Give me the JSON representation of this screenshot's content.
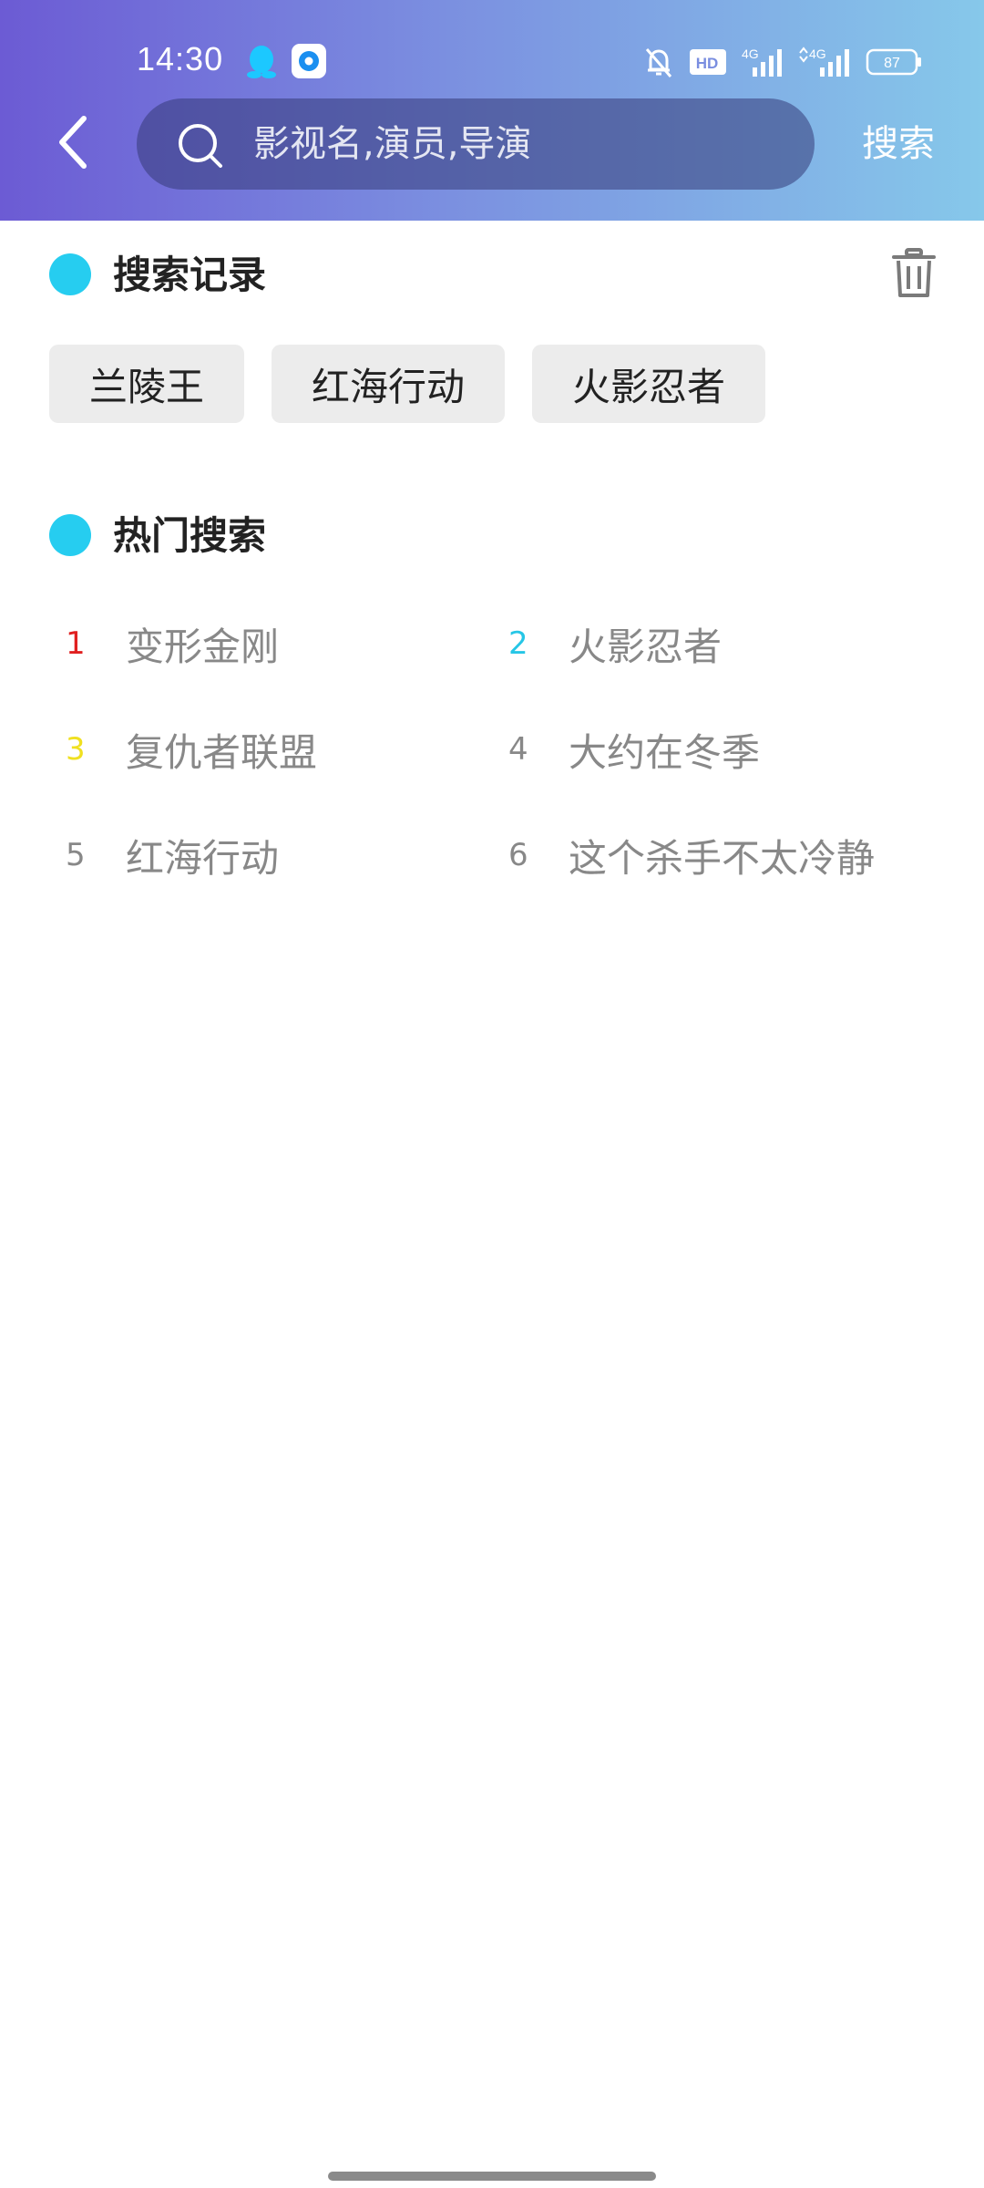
{
  "status_bar": {
    "time": "14:30",
    "battery": "87",
    "hd_badge": "HD",
    "signal_1": "4G",
    "signal_2": "4G"
  },
  "header": {
    "search_placeholder": "影视名,演员,导演",
    "search_action": "搜索"
  },
  "history": {
    "title": "搜索记录",
    "items": [
      "兰陵王",
      "红海行动",
      "火影忍者"
    ]
  },
  "hot": {
    "title": "热门搜索",
    "items": [
      {
        "rank": "1",
        "title": "变形金刚",
        "color": "#e02020"
      },
      {
        "rank": "2",
        "title": "火影忍者",
        "color": "#26c6e6"
      },
      {
        "rank": "3",
        "title": "复仇者联盟",
        "color": "#f0e020"
      },
      {
        "rank": "4",
        "title": "大约在冬季",
        "color": "#888888"
      },
      {
        "rank": "5",
        "title": "红海行动",
        "color": "#888888"
      },
      {
        "rank": "6",
        "title": "这个杀手不太冷静",
        "color": "#888888"
      }
    ]
  },
  "colors": {
    "accent_dot": "#26cdf0",
    "header_gradient_start": "#6c5bd4",
    "header_gradient_end": "#86c8ea"
  }
}
